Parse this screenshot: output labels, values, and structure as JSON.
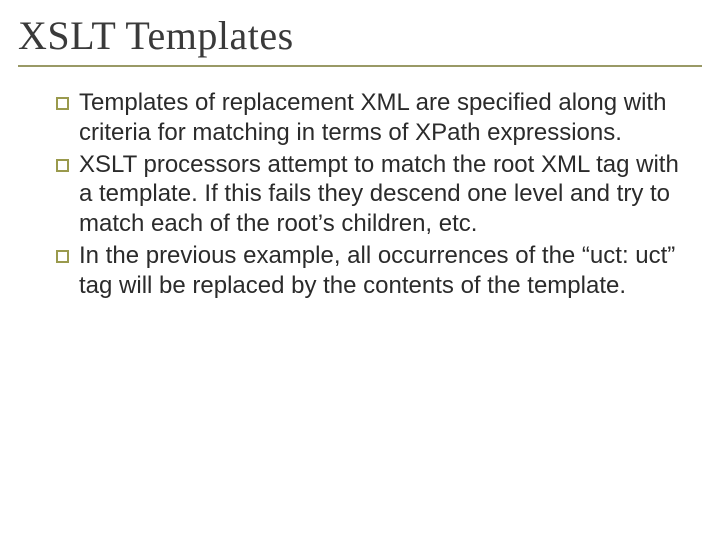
{
  "title": "XSLT Templates",
  "bullets": {
    "b1": "Templates of replacement XML are specified along with criteria for matching in terms of XPath expressions.",
    "b2": "XSLT processors attempt to match the root XML tag with a template. If this fails they descend one level and try to match each of the root’s children, etc.",
    "b3": "In the previous example, all occurrences of the “uct: uct” tag will be replaced by the contents of the template."
  }
}
